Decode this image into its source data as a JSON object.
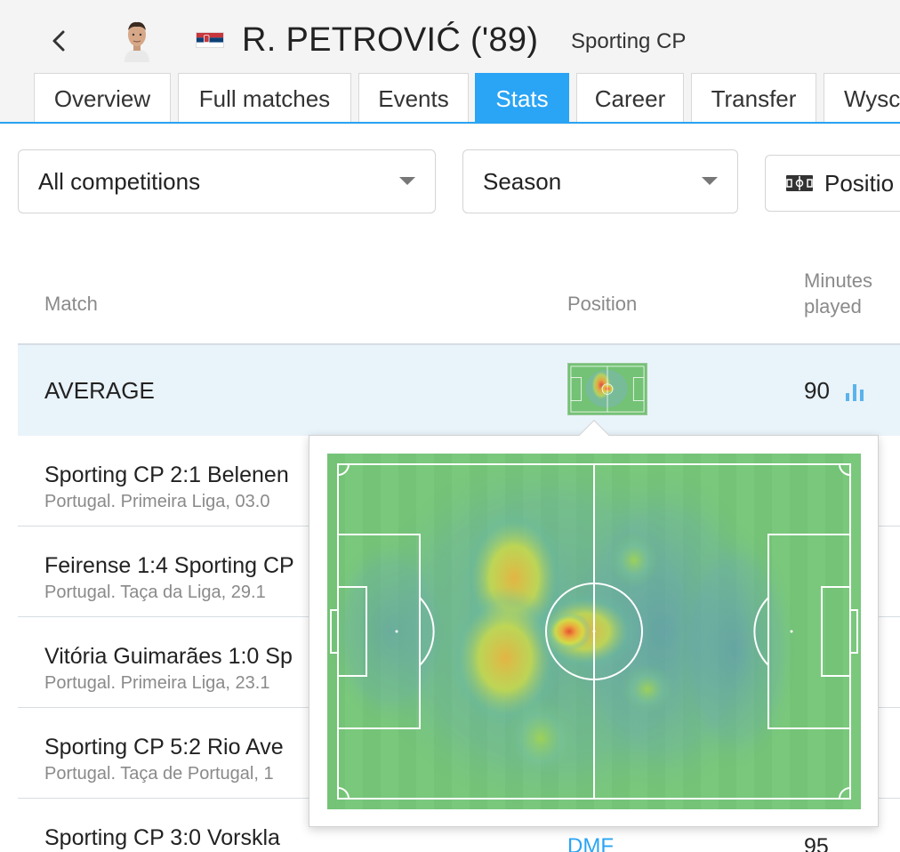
{
  "header": {
    "back_icon": "chevron-left-icon",
    "player_name": "R. PETROVIĆ ('89)",
    "team": "Sporting CP",
    "flag": "serbia-flag-icon"
  },
  "tabs": [
    {
      "label": "Overview",
      "active": false
    },
    {
      "label": "Full matches",
      "active": false
    },
    {
      "label": "Events",
      "active": false
    },
    {
      "label": "Stats",
      "active": true
    },
    {
      "label": "Career",
      "active": false
    },
    {
      "label": "Transfer",
      "active": false
    },
    {
      "label": "Wysc",
      "active": false
    }
  ],
  "filters": {
    "competition": "All competitions",
    "season": "Season",
    "position_button": "Positio"
  },
  "table": {
    "headers": {
      "match": "Match",
      "position": "Position",
      "minutes": "Minutes played"
    },
    "minutes_header_lines": [
      "Minutes",
      "played"
    ],
    "average": {
      "label": "AVERAGE",
      "minutes": "90"
    },
    "rows": [
      {
        "title": "Sporting CP 2:1 Belenen",
        "sub": "Portugal. Primeira Liga, 03.0",
        "position": "",
        "minutes": ""
      },
      {
        "title": "Feirense 1:4 Sporting CP",
        "sub": "Portugal. Taça da Liga, 29.1",
        "position": "",
        "minutes": ""
      },
      {
        "title": "Vitória Guimarães 1:0 Sp",
        "sub": "Portugal. Primeira Liga, 23.1",
        "position": "",
        "minutes": ""
      },
      {
        "title": "Sporting CP 5:2 Rio Ave",
        "sub": "Portugal. Taça de Portugal, 1",
        "position": "",
        "minutes": ""
      },
      {
        "title": "Sporting CP 3:0 Vorskla",
        "sub": "",
        "position": "DMF",
        "minutes": "95"
      }
    ]
  },
  "colors": {
    "accent": "#2aa4f4",
    "pitch_green": "#73c275",
    "average_row_bg": "#e9f3fa"
  }
}
